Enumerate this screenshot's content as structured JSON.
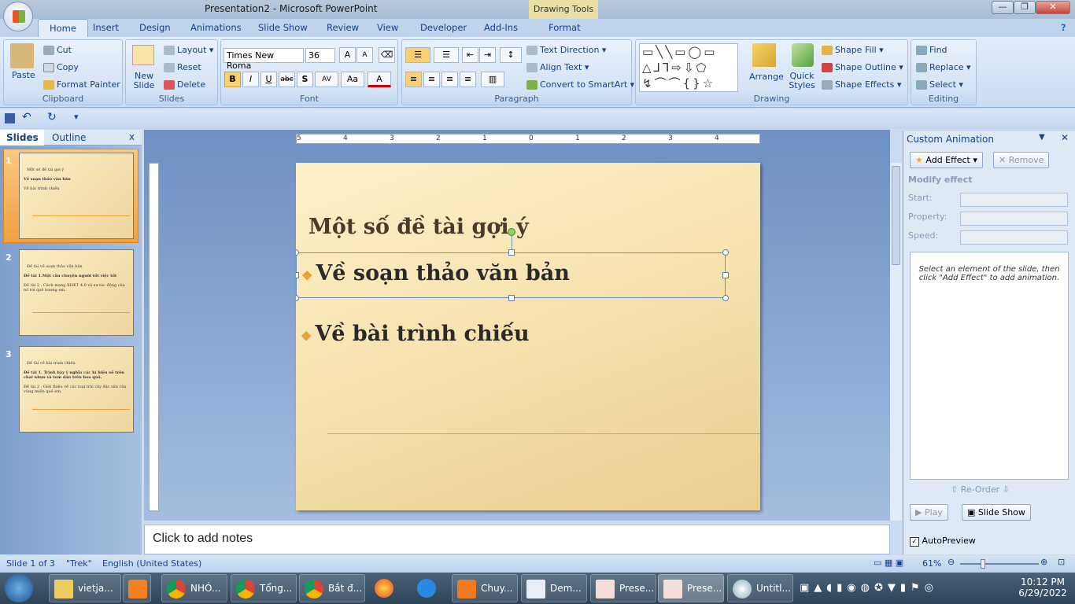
{
  "window": {
    "title": "Presentation2 - Microsoft PowerPoint",
    "context_tab": "Drawing Tools",
    "min": "—",
    "max": "❐",
    "close": "✕"
  },
  "tabs": [
    "Home",
    "Insert",
    "Design",
    "Animations",
    "Slide Show",
    "Review",
    "View",
    "Developer",
    "Add-Ins",
    "Format"
  ],
  "ribbon": {
    "clipboard": {
      "label": "Clipboard",
      "paste": "Paste",
      "cut": "Cut",
      "copy": "Copy",
      "format_painter": "Format Painter"
    },
    "slides": {
      "label": "Slides",
      "new_slide": "New Slide",
      "layout": "Layout",
      "reset": "Reset",
      "delete": "Delete"
    },
    "font": {
      "label": "Font",
      "font_name": "Times New Roma",
      "font_size": "36",
      "bold": "B",
      "italic": "I",
      "underline": "U",
      "strike": "abc",
      "shadow": "S",
      "spacing": "AV",
      "case": "Aa",
      "color": "A",
      "grow": "A",
      "shrink": "A"
    },
    "paragraph": {
      "label": "Paragraph",
      "text_direction": "Text Direction",
      "align_text": "Align Text",
      "convert_smartart": "Convert to SmartArt"
    },
    "drawing": {
      "label": "Drawing",
      "arrange": "Arrange",
      "quick_styles": "Quick Styles",
      "shape_fill": "Shape Fill",
      "shape_outline": "Shape Outline",
      "shape_effects": "Shape Effects"
    },
    "editing": {
      "label": "Editing",
      "find": "Find",
      "replace": "Replace",
      "select": "Select"
    }
  },
  "slides_pane": {
    "tabs": [
      "Slides",
      "Outline"
    ],
    "close": "x",
    "thumbs": [
      {
        "num": "1",
        "title": "Một số đề tài gợi ý",
        "bullets": [
          "Về soạn thảo văn bản",
          "Về bài trình chiếu"
        ]
      },
      {
        "num": "2",
        "title": "Đề tài về soạn thảo văn bản",
        "bullets": [
          "Đề tài 1.Một câu chuyện người tốt việc tốt",
          "Đề tài 2 : Cách mạng KHKT 4.0 và sự tác động của nó tới quê hương em."
        ]
      },
      {
        "num": "3",
        "title": "Đề tài về bài trình chiếu",
        "bullets": [
          "Đề tài 1. Trình bày ý nghĩa các kí hiệu số trên chai nhựa và tem dán trên hoa quả.",
          "Đề tài 2 : Giới thiệu về các loại trái cây đặc sản của vùng miền quê em."
        ]
      }
    ]
  },
  "ruler": {
    "h_ticks": [
      "5",
      "4",
      "3",
      "2",
      "1",
      "0",
      "1",
      "2",
      "3",
      "4"
    ]
  },
  "slide": {
    "title": "Một số đề tài gợi ý",
    "bullets": [
      "Về soạn thảo văn bản",
      "Về bài trình chiếu"
    ],
    "bullet_glyph": "❖"
  },
  "notes": {
    "placeholder": "Click to add notes"
  },
  "custom_animation": {
    "title": "Custom Animation",
    "add_effect": "Add Effect",
    "remove": "Remove",
    "modify": "Modify effect",
    "start": "Start:",
    "property": "Property:",
    "speed": "Speed:",
    "hint": "Select an element of the slide, then click \"Add Effect\" to add animation.",
    "reorder": "Re-Order",
    "play": "Play",
    "slide_show": "Slide Show",
    "autopreview": "AutoPreview",
    "autopreview_checked": true
  },
  "status": {
    "slide": "Slide 1 of 3",
    "theme": "\"Trek\"",
    "language": "English (United States)",
    "zoom": "61%",
    "zoom_level": 61
  },
  "taskbar": {
    "items": [
      "vietja...",
      "NHÓ...",
      "Tổng...",
      "Bắt đ...",
      "Chuy...",
      "Dem...",
      "Prese...",
      "Prese...",
      "Untitl..."
    ],
    "time": "10:12 PM",
    "date": "6/29/2022"
  },
  "colors": {
    "accent": "#f0a030",
    "ribbon": "#dbe7f6",
    "slide_bg": "#f6e2ae"
  }
}
